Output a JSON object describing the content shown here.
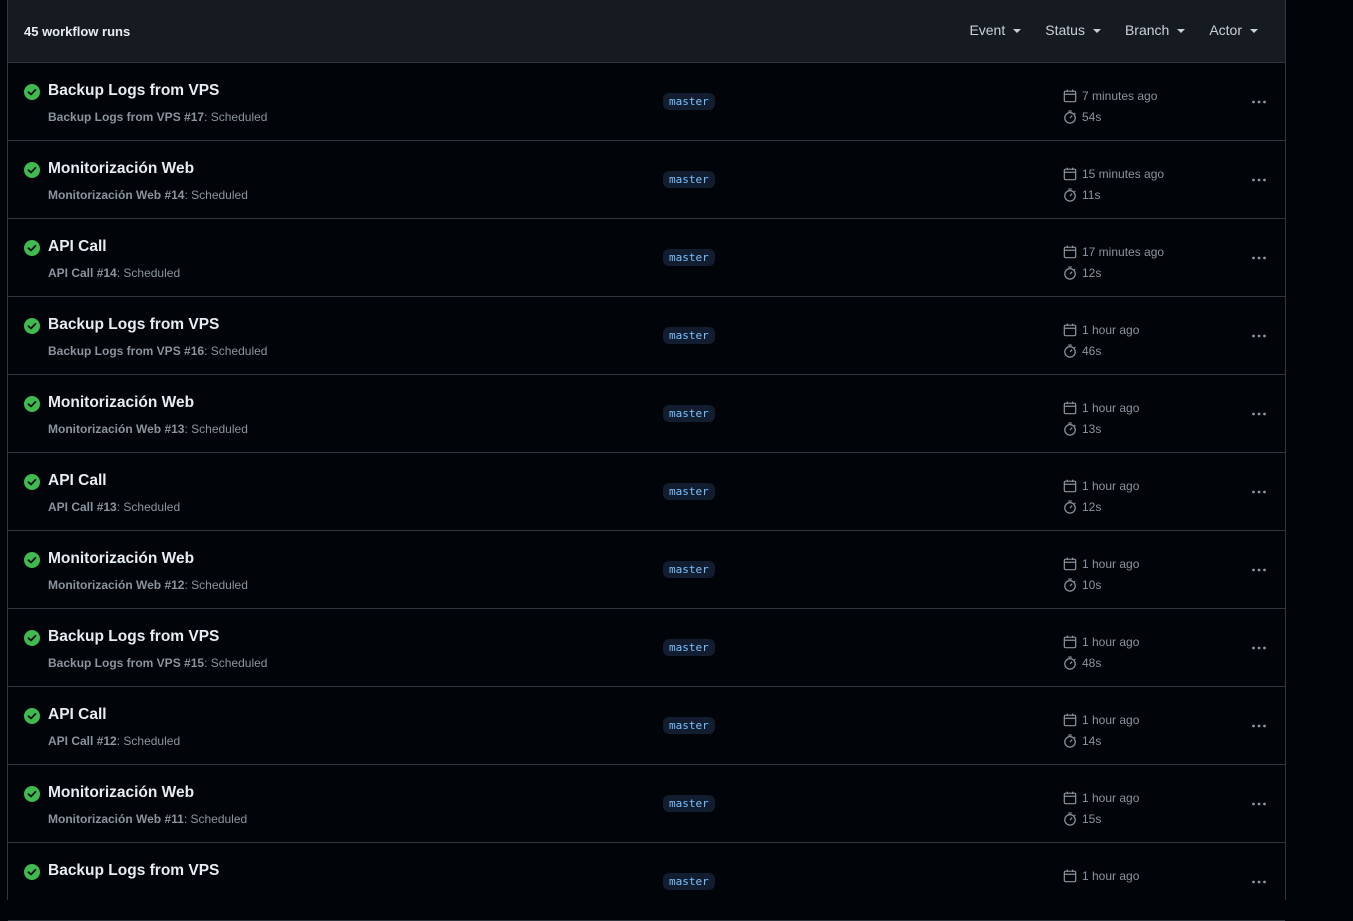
{
  "header": {
    "count": "45 workflow runs",
    "filters": [
      {
        "label": "Event"
      },
      {
        "label": "Status"
      },
      {
        "label": "Branch"
      },
      {
        "label": "Actor"
      }
    ]
  },
  "colors": {
    "success": "#3fb950",
    "branch_text": "#79c0ff",
    "branch_bg": "#121d2f"
  },
  "icons": {
    "status": "check-circle-icon",
    "date": "calendar-icon",
    "duration": "stopwatch-icon",
    "menu": "kebab-horizontal-icon"
  },
  "runs": [
    {
      "title": "Backup Logs from VPS",
      "workflow": "Backup Logs from VPS",
      "number": "#17",
      "event": ": Scheduled",
      "branch": "master",
      "time": "7 minutes ago",
      "duration": "54s"
    },
    {
      "title": "Monitorización Web",
      "workflow": "Monitorización Web",
      "number": "#14",
      "event": ": Scheduled",
      "branch": "master",
      "time": "15 minutes ago",
      "duration": "11s"
    },
    {
      "title": "API Call",
      "workflow": "API Call",
      "number": "#14",
      "event": ": Scheduled",
      "branch": "master",
      "time": "17 minutes ago",
      "duration": "12s"
    },
    {
      "title": "Backup Logs from VPS",
      "workflow": "Backup Logs from VPS",
      "number": "#16",
      "event": ": Scheduled",
      "branch": "master",
      "time": "1 hour ago",
      "duration": "46s"
    },
    {
      "title": "Monitorización Web",
      "workflow": "Monitorización Web",
      "number": "#13",
      "event": ": Scheduled",
      "branch": "master",
      "time": "1 hour ago",
      "duration": "13s"
    },
    {
      "title": "API Call",
      "workflow": "API Call",
      "number": "#13",
      "event": ": Scheduled",
      "branch": "master",
      "time": "1 hour ago",
      "duration": "12s"
    },
    {
      "title": "Monitorización Web",
      "workflow": "Monitorización Web",
      "number": "#12",
      "event": ": Scheduled",
      "branch": "master",
      "time": "1 hour ago",
      "duration": "10s"
    },
    {
      "title": "Backup Logs from VPS",
      "workflow": "Backup Logs from VPS",
      "number": "#15",
      "event": ": Scheduled",
      "branch": "master",
      "time": "1 hour ago",
      "duration": "48s"
    },
    {
      "title": "API Call",
      "workflow": "API Call",
      "number": "#12",
      "event": ": Scheduled",
      "branch": "master",
      "time": "1 hour ago",
      "duration": "14s"
    },
    {
      "title": "Monitorización Web",
      "workflow": "Monitorización Web",
      "number": "#11",
      "event": ": Scheduled",
      "branch": "master",
      "time": "1 hour ago",
      "duration": "15s"
    },
    {
      "title": "Backup Logs from VPS",
      "workflow": "",
      "number": "",
      "event": "",
      "branch": "master",
      "time": "1 hour ago",
      "duration": ""
    }
  ]
}
